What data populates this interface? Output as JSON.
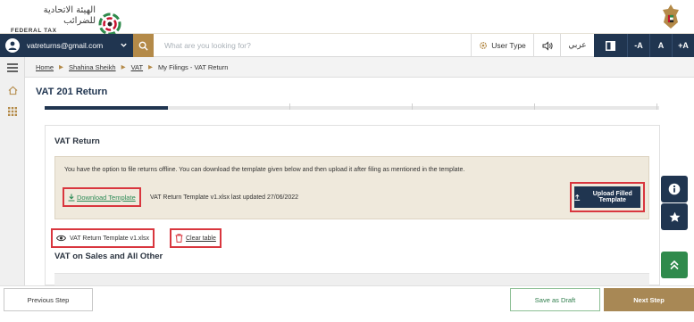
{
  "header": {
    "logo_arabic": "الهيئة الاتحادية للضرائب",
    "logo_english": "FEDERAL TAX AUTHORITY"
  },
  "nav": {
    "account_email": "vatreturns@gmail.com",
    "search_placeholder": "What are you looking for?",
    "user_type_label": "User Type",
    "language_label": "عربي",
    "font_decrease": "-A",
    "font_normal": "A",
    "font_increase": "+A"
  },
  "breadcrumb": {
    "items": [
      "Home",
      "Shahina Sheikh",
      "VAT",
      "My Filings - VAT Return"
    ]
  },
  "page": {
    "title": "VAT 201 Return",
    "progress_fraction": 0.2
  },
  "vat_return_card": {
    "title": "VAT Return",
    "info_text": "You have the option to file returns offline. You can download the template given below and then upload it after filing as mentioned in the template.",
    "download_label": "Download Template",
    "template_info": "VAT Return Template v1.xlsx last updated 27/06/2022",
    "upload_label": "Upload Filled Template",
    "uploaded_file_label": "VAT Return Template v1.xlsx",
    "clear_label": "Clear table",
    "section_title": "VAT on Sales and All Other"
  },
  "footer": {
    "previous_label": "Previous Step",
    "draft_label": "Save as Draft",
    "next_label": "Next Step"
  },
  "colors": {
    "navy": "#203550",
    "gold": "#b48a48",
    "green": "#2f8a4c",
    "highlight_red": "#d9363e"
  },
  "icons": {
    "sidebar": [
      "home-icon",
      "grid-icon"
    ],
    "floating": [
      "info-icon",
      "star-icon",
      "double-chevron-up-icon"
    ]
  }
}
